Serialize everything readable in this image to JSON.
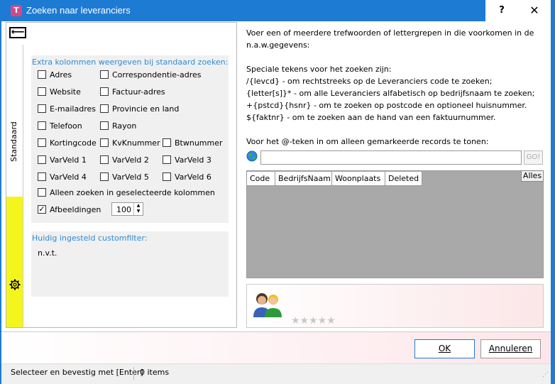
{
  "window": {
    "title": "Zoeken naar leveranciers",
    "help_label": "?",
    "close_label": "✕"
  },
  "tabs": {
    "standaard_label": "Standaard"
  },
  "extra_columns": {
    "title": "Extra kolommen weergeven bij standaard zoeken:",
    "checkboxes": [
      {
        "label": "Adres",
        "checked": false
      },
      {
        "label": "Correspondentie-adres",
        "checked": false
      },
      {
        "label": "Website",
        "checked": false
      },
      {
        "label": "Factuur-adres",
        "checked": false
      },
      {
        "label": "E-mailadres",
        "checked": false
      },
      {
        "label": "Provincie en land",
        "checked": false
      },
      {
        "label": "Telefoon",
        "checked": false
      },
      {
        "label": "Rayon",
        "checked": false
      },
      {
        "label": "Kortingcode",
        "checked": false
      },
      {
        "label": "KvKnummer",
        "checked": false
      },
      {
        "label": "Btwnummer",
        "checked": false
      },
      {
        "label": "VarVeld 1",
        "checked": false
      },
      {
        "label": "VarVeld 2",
        "checked": false
      },
      {
        "label": "VarVeld 3",
        "checked": false
      },
      {
        "label": "VarVeld 4",
        "checked": false
      },
      {
        "label": "VarVeld 5",
        "checked": false
      },
      {
        "label": "VarVeld 6",
        "checked": false
      },
      {
        "label": "Alleen zoeken in geselecteerde kolommen",
        "checked": false
      },
      {
        "label": "Afbeeldingen",
        "checked": true
      }
    ],
    "image_size_value": "100"
  },
  "custom_filter": {
    "title": "Huidig ingesteld customfilter:",
    "value": "n.v.t."
  },
  "help_text": {
    "line1": "Voer een of meerdere trefwoorden of lettergrepen in die voorkomen in de",
    "line2": "n.a.w.gegevens:",
    "line3": "Speciale tekens voor het zoeken zijn:",
    "line4": "/{levcd}  - om rechtstreeks op de Leveranciers code te zoeken;",
    "line5": "{letter[s]}*  - om alle Leveranciers alfabetisch op bedrijfsnaam te zoeken;",
    "line6": "+{pstcd}{hsnr}  - om te zoeken op postcode en optioneel huisnummer.",
    "line7": "${faktnr}  - om te zoeken aan de hand van een faktuurnummer.",
    "line8": "Voor het @-teken in om alleen gemarkeerde records te tonen:"
  },
  "search": {
    "value": "",
    "placeholder": "",
    "go_label": "GO!"
  },
  "results": {
    "columns": [
      "Code",
      "BedrijfsNaam",
      "Woonplaats",
      "Deleted"
    ],
    "alles_label": "Alles",
    "rating_stars": 0,
    "rating_max": 5
  },
  "buttons": {
    "ok_label": "OK",
    "cancel_label": "Annuleren"
  },
  "status": {
    "hint": "Selecteer en bevestig met [Enter]",
    "count": "0 items"
  },
  "colors": {
    "titlebar": "#1e7bd4",
    "section_title": "#2e8ad4",
    "yellow_tab": "#f5f51e"
  }
}
